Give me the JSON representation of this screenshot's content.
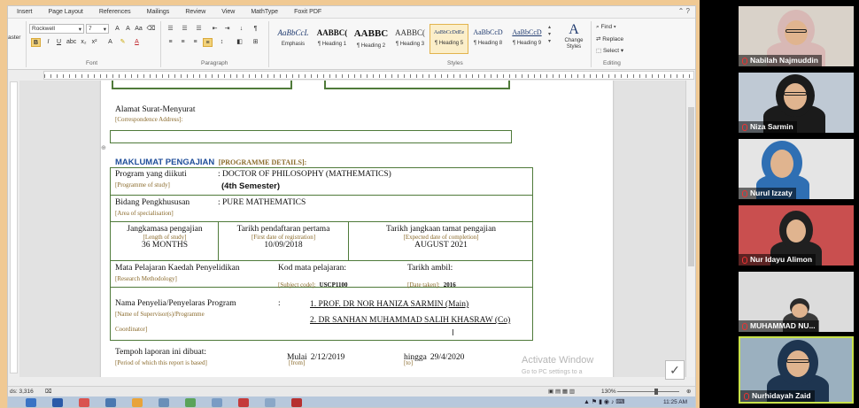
{
  "ribbon": {
    "tabs": [
      "Insert",
      "Page Layout",
      "References",
      "Mailings",
      "Review",
      "View",
      "MathType",
      "Foxit PDF"
    ],
    "font_name": "Rockwell",
    "font_size": "7",
    "groups": {
      "font": "Font",
      "paragraph": "Paragraph",
      "styles": "Styles",
      "editing": "Editing"
    },
    "paste_partial": "aster",
    "styles": [
      {
        "preview": "AaBbCcL",
        "label": "Emphasis"
      },
      {
        "preview": "AABBC(",
        "label": "¶ Heading 1"
      },
      {
        "preview": "AABBC",
        "label": "¶ Heading 2"
      },
      {
        "preview": "AABBC(",
        "label": "¶ Heading 3"
      },
      {
        "preview": "AaBbCcDdEe",
        "label": "¶ Heading 5"
      },
      {
        "preview": "AaBbCcD",
        "label": "¶ Heading 8"
      },
      {
        "preview": "AaBbCcD",
        "label": "¶ Heading 9"
      }
    ],
    "change_styles": "Change Styles",
    "find": "Find",
    "replace": "Replace",
    "select": "Select"
  },
  "document": {
    "address_label": "Alamat Surat-Menyurat",
    "address_label_en": "[Correspondence Address]:",
    "section_heading": "MAKLUMAT PENGAJIAN",
    "section_heading_en": "[PROGRAMME DETAILS]:",
    "program_label": "Program yang diikuti",
    "program_label_en": "[Programme of study]",
    "program_value": ": DOCTOR OF PHILOSOPHY (MATHEMATICS)",
    "semester_value": "(4th Semester)",
    "field_label": "Bidang Pengkhususan",
    "field_label_en": "[Area of specialisation]",
    "field_value": ": PURE MATHEMATICS",
    "duration_label": "Jangkamasa pengajian",
    "duration_label_en": "[Length of study]",
    "duration_value": "36 MONTHS",
    "reg_label": "Tarikh pendaftaran pertama",
    "reg_label_en": "[First date of registration]",
    "reg_value": "10/09/2018",
    "completion_label": "Tarikh jangkaan tamat pengajian",
    "completion_label_en": "[Expected date of completion]",
    "completion_value": "AUGUST 2021",
    "course_label": "Mata Pelajaran Kaedah Penyelidikan",
    "course_label_en": "[Research Methodology]",
    "code_label": "Kod mata pelajaran:",
    "code_label_en": "[Subject code]:",
    "code_value": "USCP1100",
    "taken_label": "Tarikh ambil:",
    "taken_label_en": "[Date taken]:",
    "taken_value": "2016",
    "supervisor_label": "Nama Penyelia/Penyelaras Program",
    "supervisor_label_en": "[Name of Supervisor(s)/Programme",
    "supervisor_label_en2": "Coordinator]",
    "supervisor_colon": ":",
    "supervisors": [
      "1.   PROF. DR NOR HANIZA SARMIN (Main)",
      "2.   DR SANHAN MUHAMMAD SALIH KHASRAW (Co)"
    ],
    "period_label": "Tempoh laporan ini dibuat:",
    "period_label_en": "[Period of which this report is based]",
    "from_label": "Mulai",
    "from_value": "2/12/2019",
    "from_label_en": "[from]",
    "to_label": "hingga",
    "to_value": "29/4/2020",
    "to_label_en": "[to]"
  },
  "watermark": {
    "line1": "Activate Window",
    "line2": "Go to PC settings to a"
  },
  "status": {
    "words": "ds: 3,316",
    "zoom": "130%",
    "time": "11:25 AM"
  },
  "participants": [
    {
      "name": "Nabilah Najmuddin",
      "bg": "#d9d2c9",
      "hijab": "#d8b8b5"
    },
    {
      "name": "Niza Sarmin",
      "bg": "#bfc9d4",
      "hijab": "#1b1b1b"
    },
    {
      "name": "Nurul Izzaty",
      "bg": "#e5e5e5",
      "hijab": "#2f6fb3"
    },
    {
      "name": "Nur Idayu Alimon",
      "bg": "#c94f4f",
      "hijab": "#202020"
    },
    {
      "name": "MUHAMMAD NU...",
      "bg": "#dcdcdc",
      "hijab": "#2a2a2a"
    },
    {
      "name": "Nurhidayah Zaid",
      "bg": "#9bb0bf",
      "hijab": "#1e3550"
    }
  ]
}
